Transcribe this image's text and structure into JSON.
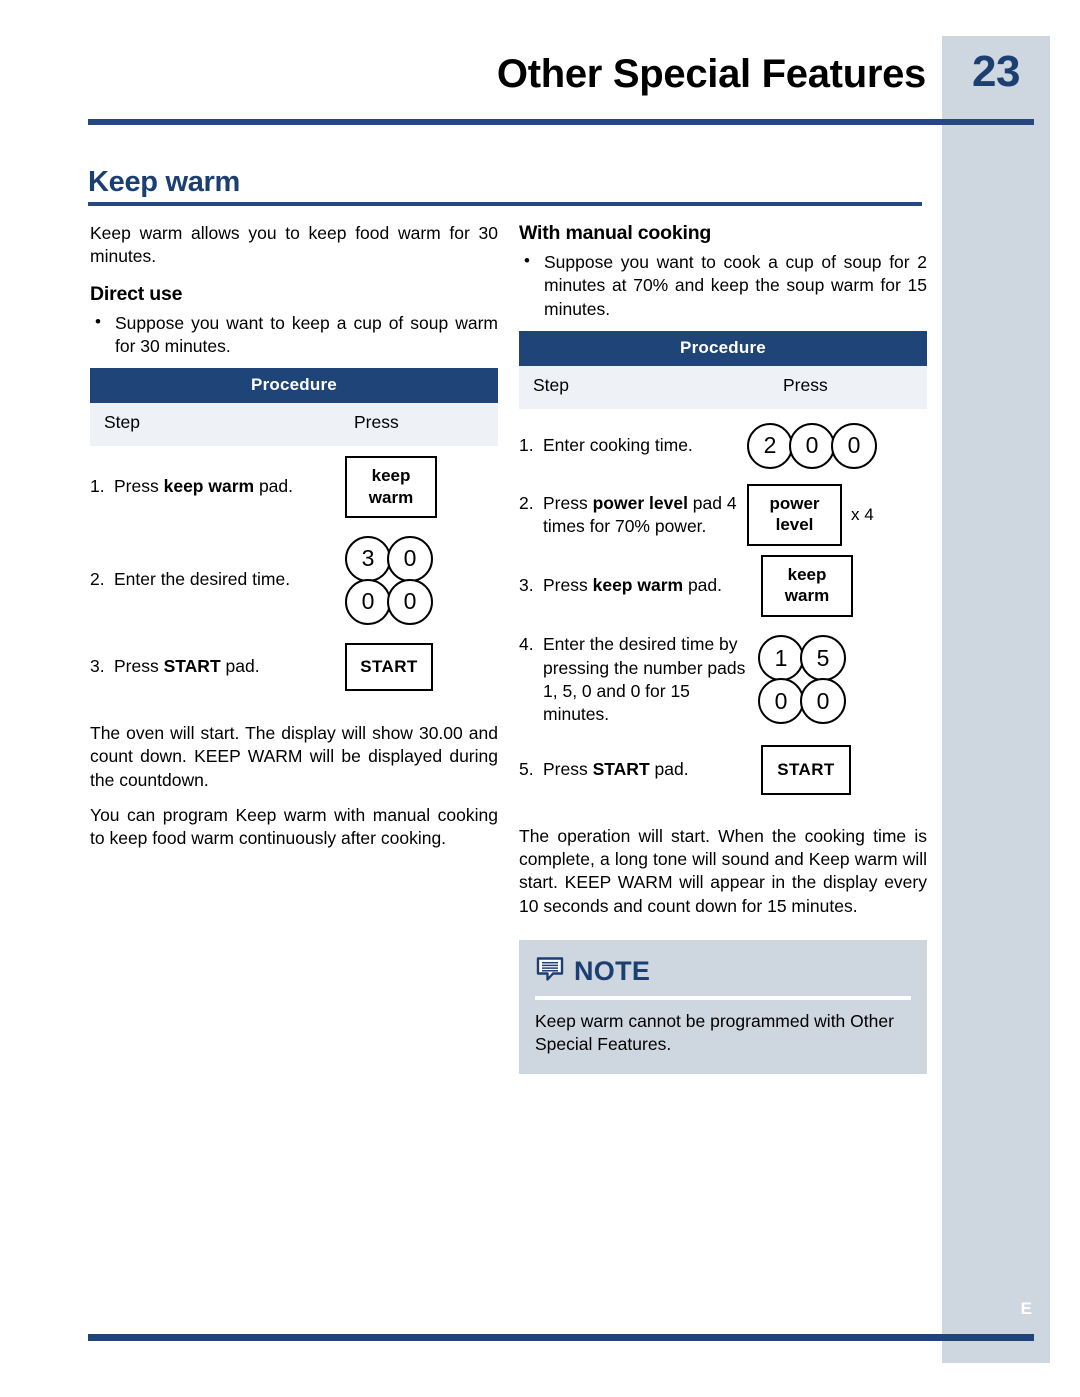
{
  "page": {
    "chapter_title": "Other Special Features",
    "page_number": "23",
    "edge_letter": "E"
  },
  "section": {
    "title": "Keep warm",
    "intro": "Keep warm allows you to keep food warm for 30 minutes."
  },
  "left": {
    "subhead": "Direct use",
    "bullet": "Suppose you want to keep a cup of soup warm for 30 minutes.",
    "table": {
      "header": "Procedure",
      "col_step": "Step",
      "col_press": "Press",
      "rows": [
        {
          "num": "1.",
          "text_pre": "Press ",
          "text_bold": "keep warm",
          "text_post": " pad.",
          "pad_line1": "keep",
          "pad_line2": "warm"
        },
        {
          "num": "2.",
          "text_pre": "Enter the desired time.",
          "text_bold": "",
          "text_post": "",
          "keys_row1": [
            "3",
            "0"
          ],
          "keys_row2": [
            "0",
            "0"
          ]
        },
        {
          "num": "3.",
          "text_pre": "Press ",
          "text_bold": "START",
          "text_post": " pad.",
          "pad_label": "START"
        }
      ]
    },
    "para1": "The oven will start. The display will show 30.00 and count down. KEEP WARM will be displayed during the countdown.",
    "para2": "You can program Keep warm with manual cooking to keep food warm continuously after cooking."
  },
  "right": {
    "subhead": "With manual cooking",
    "bullet": "Suppose you want to cook a cup of soup for 2 minutes at 70% and keep the soup warm for 15 minutes.",
    "table": {
      "header": "Procedure",
      "col_step": "Step",
      "col_press": "Press",
      "rows": [
        {
          "num": "1.",
          "text_pre": "Enter cooking time.",
          "text_bold": "",
          "text_post": "",
          "keys_row1": [
            "2",
            "0",
            "0"
          ]
        },
        {
          "num": "2.",
          "text_pre": "Press ",
          "text_bold": "power level",
          "text_post": " pad 4 times for 70% power.",
          "pad_line1": "power",
          "pad_line2": "level",
          "multiplier": "x 4"
        },
        {
          "num": "3.",
          "text_pre": "Press ",
          "text_bold": "keep warm",
          "text_post": " pad.",
          "pad_line1": "keep",
          "pad_line2": "warm"
        },
        {
          "num": "4.",
          "text_pre": "Enter the desired time by pressing the number pads 1, 5, 0 and 0 for 15 minutes.",
          "text_bold": "",
          "text_post": "",
          "keys_row1": [
            "1",
            "5"
          ],
          "keys_row2": [
            "0",
            "0"
          ]
        },
        {
          "num": "5.",
          "text_pre": "Press ",
          "text_bold": "START",
          "text_post": " pad.",
          "pad_label": "START"
        }
      ]
    },
    "para1": "The operation will start. When the cooking time is complete, a long tone will sound and Keep warm will start. KEEP WARM will appear in the display every 10 seconds and count down for 15 minutes.",
    "note": {
      "title": "NOTE",
      "body": "Keep warm cannot be programmed with Other Special Features."
    }
  },
  "colors": {
    "navy": "#1f4478",
    "heading_blue": "#1c3f72",
    "side_tab": "#ced6e0",
    "subhead_row": "#eef1f5"
  }
}
